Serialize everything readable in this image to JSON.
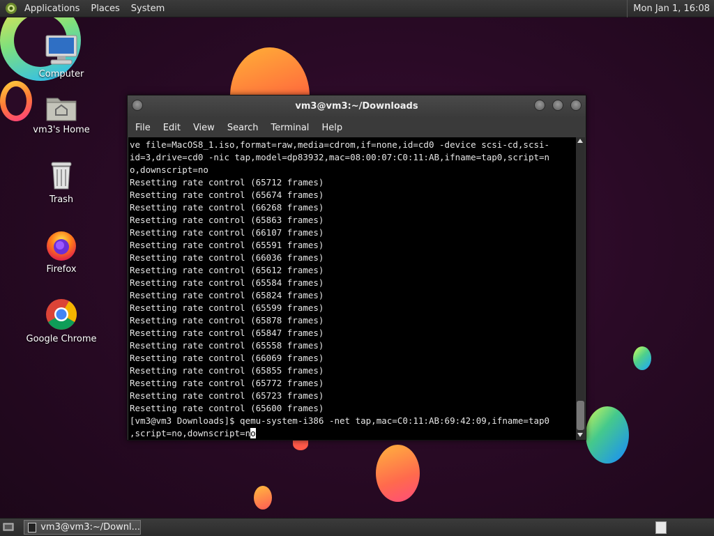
{
  "top_panel": {
    "menus": [
      "Applications",
      "Places",
      "System"
    ],
    "clock": "Mon Jan 1, 16:08"
  },
  "desktop_icons": [
    {
      "label": "Computer",
      "icon": "computer-icon"
    },
    {
      "label": "vm3's Home",
      "icon": "home-folder-icon"
    },
    {
      "label": "Trash",
      "icon": "trash-icon"
    },
    {
      "label": "Firefox",
      "icon": "firefox-icon"
    },
    {
      "label": "Google Chrome",
      "icon": "chrome-icon"
    }
  ],
  "terminal": {
    "title": "vm3@vm3:~/Downloads",
    "menu": [
      "File",
      "Edit",
      "View",
      "Search",
      "Terminal",
      "Help"
    ],
    "lines": [
      "ve file=MacOS8_1.iso,format=raw,media=cdrom,if=none,id=cd0 -device scsi-cd,scsi-",
      "id=3,drive=cd0 -nic tap,model=dp83932,mac=08:00:07:C0:11:AB,ifname=tap0,script=n",
      "o,downscript=no",
      "Resetting rate control (65712 frames)",
      "Resetting rate control (65674 frames)",
      "Resetting rate control (66268 frames)",
      "Resetting rate control (65863 frames)",
      "Resetting rate control (66107 frames)",
      "Resetting rate control (65591 frames)",
      "Resetting rate control (66036 frames)",
      "Resetting rate control (65612 frames)",
      "Resetting rate control (65584 frames)",
      "Resetting rate control (65824 frames)",
      "Resetting rate control (65599 frames)",
      "Resetting rate control (65878 frames)",
      "Resetting rate control (65847 frames)",
      "Resetting rate control (65558 frames)",
      "Resetting rate control (66069 frames)",
      "Resetting rate control (65855 frames)",
      "Resetting rate control (65772 frames)",
      "Resetting rate control (65723 frames)",
      "Resetting rate control (65600 frames)",
      "[vm3@vm3 Downloads]$ qemu-system-i386 -net tap,mac=C0:11:AB:69:42:09,ifname=tap0"
    ],
    "prompt_tail": ",script=no,downscript=n",
    "cursor_char": "o"
  },
  "taskbar": {
    "item_label": "vm3@vm3:~/Downl..."
  }
}
